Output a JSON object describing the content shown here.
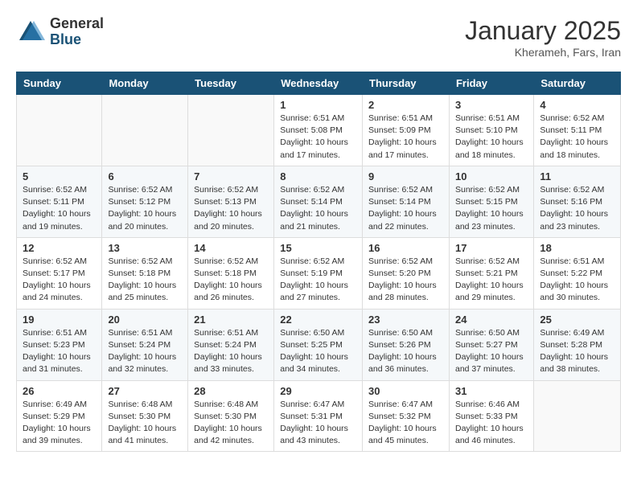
{
  "header": {
    "logo_general": "General",
    "logo_blue": "Blue",
    "month_title": "January 2025",
    "location": "Kherameh, Fars, Iran"
  },
  "weekdays": [
    "Sunday",
    "Monday",
    "Tuesday",
    "Wednesday",
    "Thursday",
    "Friday",
    "Saturday"
  ],
  "weeks": [
    [
      {
        "day": "",
        "info": ""
      },
      {
        "day": "",
        "info": ""
      },
      {
        "day": "",
        "info": ""
      },
      {
        "day": "1",
        "info": "Sunrise: 6:51 AM\nSunset: 5:08 PM\nDaylight: 10 hours\nand 17 minutes."
      },
      {
        "day": "2",
        "info": "Sunrise: 6:51 AM\nSunset: 5:09 PM\nDaylight: 10 hours\nand 17 minutes."
      },
      {
        "day": "3",
        "info": "Sunrise: 6:51 AM\nSunset: 5:10 PM\nDaylight: 10 hours\nand 18 minutes."
      },
      {
        "day": "4",
        "info": "Sunrise: 6:52 AM\nSunset: 5:11 PM\nDaylight: 10 hours\nand 18 minutes."
      }
    ],
    [
      {
        "day": "5",
        "info": "Sunrise: 6:52 AM\nSunset: 5:11 PM\nDaylight: 10 hours\nand 19 minutes."
      },
      {
        "day": "6",
        "info": "Sunrise: 6:52 AM\nSunset: 5:12 PM\nDaylight: 10 hours\nand 20 minutes."
      },
      {
        "day": "7",
        "info": "Sunrise: 6:52 AM\nSunset: 5:13 PM\nDaylight: 10 hours\nand 20 minutes."
      },
      {
        "day": "8",
        "info": "Sunrise: 6:52 AM\nSunset: 5:14 PM\nDaylight: 10 hours\nand 21 minutes."
      },
      {
        "day": "9",
        "info": "Sunrise: 6:52 AM\nSunset: 5:14 PM\nDaylight: 10 hours\nand 22 minutes."
      },
      {
        "day": "10",
        "info": "Sunrise: 6:52 AM\nSunset: 5:15 PM\nDaylight: 10 hours\nand 23 minutes."
      },
      {
        "day": "11",
        "info": "Sunrise: 6:52 AM\nSunset: 5:16 PM\nDaylight: 10 hours\nand 23 minutes."
      }
    ],
    [
      {
        "day": "12",
        "info": "Sunrise: 6:52 AM\nSunset: 5:17 PM\nDaylight: 10 hours\nand 24 minutes."
      },
      {
        "day": "13",
        "info": "Sunrise: 6:52 AM\nSunset: 5:18 PM\nDaylight: 10 hours\nand 25 minutes."
      },
      {
        "day": "14",
        "info": "Sunrise: 6:52 AM\nSunset: 5:18 PM\nDaylight: 10 hours\nand 26 minutes."
      },
      {
        "day": "15",
        "info": "Sunrise: 6:52 AM\nSunset: 5:19 PM\nDaylight: 10 hours\nand 27 minutes."
      },
      {
        "day": "16",
        "info": "Sunrise: 6:52 AM\nSunset: 5:20 PM\nDaylight: 10 hours\nand 28 minutes."
      },
      {
        "day": "17",
        "info": "Sunrise: 6:52 AM\nSunset: 5:21 PM\nDaylight: 10 hours\nand 29 minutes."
      },
      {
        "day": "18",
        "info": "Sunrise: 6:51 AM\nSunset: 5:22 PM\nDaylight: 10 hours\nand 30 minutes."
      }
    ],
    [
      {
        "day": "19",
        "info": "Sunrise: 6:51 AM\nSunset: 5:23 PM\nDaylight: 10 hours\nand 31 minutes."
      },
      {
        "day": "20",
        "info": "Sunrise: 6:51 AM\nSunset: 5:24 PM\nDaylight: 10 hours\nand 32 minutes."
      },
      {
        "day": "21",
        "info": "Sunrise: 6:51 AM\nSunset: 5:24 PM\nDaylight: 10 hours\nand 33 minutes."
      },
      {
        "day": "22",
        "info": "Sunrise: 6:50 AM\nSunset: 5:25 PM\nDaylight: 10 hours\nand 34 minutes."
      },
      {
        "day": "23",
        "info": "Sunrise: 6:50 AM\nSunset: 5:26 PM\nDaylight: 10 hours\nand 36 minutes."
      },
      {
        "day": "24",
        "info": "Sunrise: 6:50 AM\nSunset: 5:27 PM\nDaylight: 10 hours\nand 37 minutes."
      },
      {
        "day": "25",
        "info": "Sunrise: 6:49 AM\nSunset: 5:28 PM\nDaylight: 10 hours\nand 38 minutes."
      }
    ],
    [
      {
        "day": "26",
        "info": "Sunrise: 6:49 AM\nSunset: 5:29 PM\nDaylight: 10 hours\nand 39 minutes."
      },
      {
        "day": "27",
        "info": "Sunrise: 6:48 AM\nSunset: 5:30 PM\nDaylight: 10 hours\nand 41 minutes."
      },
      {
        "day": "28",
        "info": "Sunrise: 6:48 AM\nSunset: 5:30 PM\nDaylight: 10 hours\nand 42 minutes."
      },
      {
        "day": "29",
        "info": "Sunrise: 6:47 AM\nSunset: 5:31 PM\nDaylight: 10 hours\nand 43 minutes."
      },
      {
        "day": "30",
        "info": "Sunrise: 6:47 AM\nSunset: 5:32 PM\nDaylight: 10 hours\nand 45 minutes."
      },
      {
        "day": "31",
        "info": "Sunrise: 6:46 AM\nSunset: 5:33 PM\nDaylight: 10 hours\nand 46 minutes."
      },
      {
        "day": "",
        "info": ""
      }
    ]
  ]
}
